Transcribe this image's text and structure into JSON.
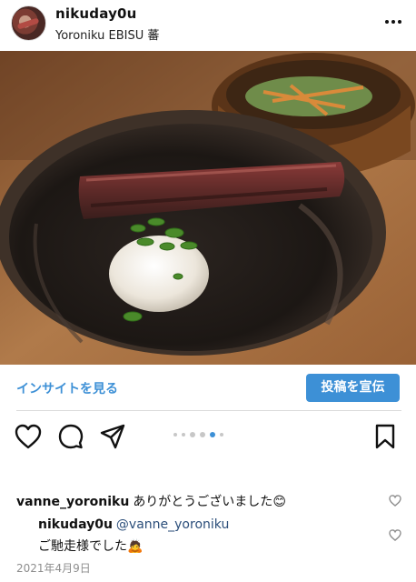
{
  "post": {
    "username": "nikuday0u",
    "location": "Yoroniku EBISU 蕃"
  },
  "actions": {
    "insights_label": "インサイトを見る",
    "promote_label": "投稿を宣伝"
  },
  "carousel": {
    "count": 6,
    "active_index": 4
  },
  "comments": [
    {
      "user": "vanne_yoroniku",
      "text": "ありがとうございました",
      "emoji": "😊"
    },
    {
      "user": "nikuday0u",
      "mention": "@vanne_yoroniku",
      "text": "ご馳走様でした",
      "emoji": "🙇"
    }
  ],
  "date": "2021年4月9日",
  "colors": {
    "accent": "#3d90d6",
    "divider": "#dbdbdb"
  },
  "icons": [
    "more-icon",
    "heart-icon",
    "comment-icon",
    "share-icon",
    "bookmark-icon"
  ]
}
